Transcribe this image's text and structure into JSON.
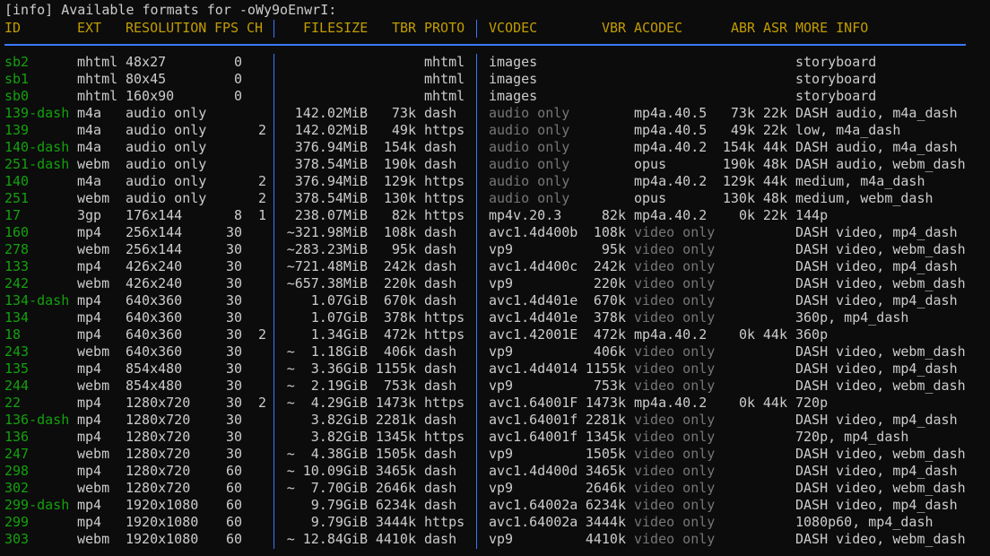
{
  "info_line": "[info] Available formats for -oWy9oEnwrI:",
  "colors": {
    "accent": "#3b78ff",
    "header": "#c19c00",
    "id": "#13a10e",
    "dim": "#767676",
    "text": "#cccccc",
    "bg": "#0c0c0c"
  },
  "headers": {
    "id": "ID",
    "ext": "EXT",
    "resolution": "RESOLUTION",
    "fps": "FPS",
    "ch": "CH",
    "filesize": "FILESIZE",
    "tbr": "TBR",
    "proto": "PROTO",
    "vcodec": "VCODEC",
    "vbr": "VBR",
    "acodec": "ACODEC",
    "abr": "ABR",
    "asr": "ASR",
    "more_info": "MORE INFO"
  },
  "rows": [
    {
      "id": "sb2",
      "ext": "mhtml",
      "res": "48x27",
      "fps": "0",
      "ch": "",
      "size": "",
      "tbr": "",
      "proto": "mhtml",
      "vcodec": "images",
      "vbr": "",
      "acodec": "",
      "abr": "",
      "asr": "",
      "info": "storyboard"
    },
    {
      "id": "sb1",
      "ext": "mhtml",
      "res": "80x45",
      "fps": "0",
      "ch": "",
      "size": "",
      "tbr": "",
      "proto": "mhtml",
      "vcodec": "images",
      "vbr": "",
      "acodec": "",
      "abr": "",
      "asr": "",
      "info": "storyboard"
    },
    {
      "id": "sb0",
      "ext": "mhtml",
      "res": "160x90",
      "fps": "0",
      "ch": "",
      "size": "",
      "tbr": "",
      "proto": "mhtml",
      "vcodec": "images",
      "vbr": "",
      "acodec": "",
      "abr": "",
      "asr": "",
      "info": "storyboard"
    },
    {
      "id": "139-dash",
      "ext": "m4a",
      "res": "audio only",
      "fps": "",
      "ch": "",
      "size": "142.02MiB",
      "tbr": "73k",
      "proto": "dash",
      "vcodec": "audio only",
      "vbr": "",
      "acodec": "mp4a.40.5",
      "abr": "73k",
      "asr": "22k",
      "info": "DASH audio, m4a_dash"
    },
    {
      "id": "139",
      "ext": "m4a",
      "res": "audio only",
      "fps": "",
      "ch": "2",
      "size": "142.02MiB",
      "tbr": "49k",
      "proto": "https",
      "vcodec": "audio only",
      "vbr": "",
      "acodec": "mp4a.40.5",
      "abr": "49k",
      "asr": "22k",
      "info": "low, m4a_dash"
    },
    {
      "id": "140-dash",
      "ext": "m4a",
      "res": "audio only",
      "fps": "",
      "ch": "",
      "size": "376.94MiB",
      "tbr": "154k",
      "proto": "dash",
      "vcodec": "audio only",
      "vbr": "",
      "acodec": "mp4a.40.2",
      "abr": "154k",
      "asr": "44k",
      "info": "DASH audio, m4a_dash"
    },
    {
      "id": "251-dash",
      "ext": "webm",
      "res": "audio only",
      "fps": "",
      "ch": "",
      "size": "378.54MiB",
      "tbr": "190k",
      "proto": "dash",
      "vcodec": "audio only",
      "vbr": "",
      "acodec": "opus",
      "abr": "190k",
      "asr": "48k",
      "info": "DASH audio, webm_dash"
    },
    {
      "id": "140",
      "ext": "m4a",
      "res": "audio only",
      "fps": "",
      "ch": "2",
      "size": "376.94MiB",
      "tbr": "129k",
      "proto": "https",
      "vcodec": "audio only",
      "vbr": "",
      "acodec": "mp4a.40.2",
      "abr": "129k",
      "asr": "44k",
      "info": "medium, m4a_dash"
    },
    {
      "id": "251",
      "ext": "webm",
      "res": "audio only",
      "fps": "",
      "ch": "2",
      "size": "378.54MiB",
      "tbr": "130k",
      "proto": "https",
      "vcodec": "audio only",
      "vbr": "",
      "acodec": "opus",
      "abr": "130k",
      "asr": "48k",
      "info": "medium, webm_dash"
    },
    {
      "id": "17",
      "ext": "3gp",
      "res": "176x144",
      "fps": "8",
      "ch": "1",
      "size": "238.07MiB",
      "tbr": "82k",
      "proto": "https",
      "vcodec": "mp4v.20.3",
      "vbr": "82k",
      "acodec": "mp4a.40.2",
      "abr": "0k",
      "asr": "22k",
      "info": "144p"
    },
    {
      "id": "160",
      "ext": "mp4",
      "res": "256x144",
      "fps": "30",
      "ch": "",
      "size": "~321.98MiB",
      "tbr": "108k",
      "proto": "dash",
      "vcodec": "avc1.4d400b",
      "vbr": "108k",
      "acodec": "video only",
      "abr": "",
      "asr": "",
      "info": "DASH video, mp4_dash"
    },
    {
      "id": "278",
      "ext": "webm",
      "res": "256x144",
      "fps": "30",
      "ch": "",
      "size": "~283.23MiB",
      "tbr": "95k",
      "proto": "dash",
      "vcodec": "vp9",
      "vbr": "95k",
      "acodec": "video only",
      "abr": "",
      "asr": "",
      "info": "DASH video, webm_dash"
    },
    {
      "id": "133",
      "ext": "mp4",
      "res": "426x240",
      "fps": "30",
      "ch": "",
      "size": "~721.48MiB",
      "tbr": "242k",
      "proto": "dash",
      "vcodec": "avc1.4d400c",
      "vbr": "242k",
      "acodec": "video only",
      "abr": "",
      "asr": "",
      "info": "DASH video, mp4_dash"
    },
    {
      "id": "242",
      "ext": "webm",
      "res": "426x240",
      "fps": "30",
      "ch": "",
      "size": "~657.38MiB",
      "tbr": "220k",
      "proto": "dash",
      "vcodec": "vp9",
      "vbr": "220k",
      "acodec": "video only",
      "abr": "",
      "asr": "",
      "info": "DASH video, webm_dash"
    },
    {
      "id": "134-dash",
      "ext": "mp4",
      "res": "640x360",
      "fps": "30",
      "ch": "",
      "size": "1.07GiB",
      "tbr": "670k",
      "proto": "dash",
      "vcodec": "avc1.4d401e",
      "vbr": "670k",
      "acodec": "video only",
      "abr": "",
      "asr": "",
      "info": "DASH video, mp4_dash"
    },
    {
      "id": "134",
      "ext": "mp4",
      "res": "640x360",
      "fps": "30",
      "ch": "",
      "size": "1.07GiB",
      "tbr": "378k",
      "proto": "https",
      "vcodec": "avc1.4d401e",
      "vbr": "378k",
      "acodec": "video only",
      "abr": "",
      "asr": "",
      "info": "360p, mp4_dash"
    },
    {
      "id": "18",
      "ext": "mp4",
      "res": "640x360",
      "fps": "30",
      "ch": "2",
      "size": "1.34GiB",
      "tbr": "472k",
      "proto": "https",
      "vcodec": "avc1.42001E",
      "vbr": "472k",
      "acodec": "mp4a.40.2",
      "abr": "0k",
      "asr": "44k",
      "info": "360p"
    },
    {
      "id": "243",
      "ext": "webm",
      "res": "640x360",
      "fps": "30",
      "ch": "",
      "size": "~  1.18GiB",
      "tbr": "406k",
      "proto": "dash",
      "vcodec": "vp9",
      "vbr": "406k",
      "acodec": "video only",
      "abr": "",
      "asr": "",
      "info": "DASH video, webm_dash"
    },
    {
      "id": "135",
      "ext": "mp4",
      "res": "854x480",
      "fps": "30",
      "ch": "",
      "size": "~  3.36GiB",
      "tbr": "1155k",
      "proto": "dash",
      "vcodec": "avc1.4d4014",
      "vbr": "1155k",
      "acodec": "video only",
      "abr": "",
      "asr": "",
      "info": "DASH video, mp4_dash"
    },
    {
      "id": "244",
      "ext": "webm",
      "res": "854x480",
      "fps": "30",
      "ch": "",
      "size": "~  2.19GiB",
      "tbr": "753k",
      "proto": "dash",
      "vcodec": "vp9",
      "vbr": "753k",
      "acodec": "video only",
      "abr": "",
      "asr": "",
      "info": "DASH video, webm_dash"
    },
    {
      "id": "22",
      "ext": "mp4",
      "res": "1280x720",
      "fps": "30",
      "ch": "2",
      "size": "~  4.29GiB",
      "tbr": "1473k",
      "proto": "https",
      "vcodec": "avc1.64001F",
      "vbr": "1473k",
      "acodec": "mp4a.40.2",
      "abr": "0k",
      "asr": "44k",
      "info": "720p"
    },
    {
      "id": "136-dash",
      "ext": "mp4",
      "res": "1280x720",
      "fps": "30",
      "ch": "",
      "size": "3.82GiB",
      "tbr": "2281k",
      "proto": "dash",
      "vcodec": "avc1.64001f",
      "vbr": "2281k",
      "acodec": "video only",
      "abr": "",
      "asr": "",
      "info": "DASH video, mp4_dash"
    },
    {
      "id": "136",
      "ext": "mp4",
      "res": "1280x720",
      "fps": "30",
      "ch": "",
      "size": "3.82GiB",
      "tbr": "1345k",
      "proto": "https",
      "vcodec": "avc1.64001f",
      "vbr": "1345k",
      "acodec": "video only",
      "abr": "",
      "asr": "",
      "info": "720p, mp4_dash"
    },
    {
      "id": "247",
      "ext": "webm",
      "res": "1280x720",
      "fps": "30",
      "ch": "",
      "size": "~  4.38GiB",
      "tbr": "1505k",
      "proto": "dash",
      "vcodec": "vp9",
      "vbr": "1505k",
      "acodec": "video only",
      "abr": "",
      "asr": "",
      "info": "DASH video, webm_dash"
    },
    {
      "id": "298",
      "ext": "mp4",
      "res": "1280x720",
      "fps": "60",
      "ch": "",
      "size": "~ 10.09GiB",
      "tbr": "3465k",
      "proto": "dash",
      "vcodec": "avc1.4d400d",
      "vbr": "3465k",
      "acodec": "video only",
      "abr": "",
      "asr": "",
      "info": "DASH video, mp4_dash"
    },
    {
      "id": "302",
      "ext": "webm",
      "res": "1280x720",
      "fps": "60",
      "ch": "",
      "size": "~  7.70GiB",
      "tbr": "2646k",
      "proto": "dash",
      "vcodec": "vp9",
      "vbr": "2646k",
      "acodec": "video only",
      "abr": "",
      "asr": "",
      "info": "DASH video, webm_dash"
    },
    {
      "id": "299-dash",
      "ext": "mp4",
      "res": "1920x1080",
      "fps": "60",
      "ch": "",
      "size": "9.79GiB",
      "tbr": "6234k",
      "proto": "dash",
      "vcodec": "avc1.64002a",
      "vbr": "6234k",
      "acodec": "video only",
      "abr": "",
      "asr": "",
      "info": "DASH video, mp4_dash"
    },
    {
      "id": "299",
      "ext": "mp4",
      "res": "1920x1080",
      "fps": "60",
      "ch": "",
      "size": "9.79GiB",
      "tbr": "3444k",
      "proto": "https",
      "vcodec": "avc1.64002a",
      "vbr": "3444k",
      "acodec": "video only",
      "abr": "",
      "asr": "",
      "info": "1080p60, mp4_dash"
    },
    {
      "id": "303",
      "ext": "webm",
      "res": "1920x1080",
      "fps": "60",
      "ch": "",
      "size": "~ 12.84GiB",
      "tbr": "4410k",
      "proto": "dash",
      "vcodec": "vp9",
      "vbr": "4410k",
      "acodec": "video only",
      "abr": "",
      "asr": "",
      "info": "DASH video, webm_dash"
    }
  ]
}
